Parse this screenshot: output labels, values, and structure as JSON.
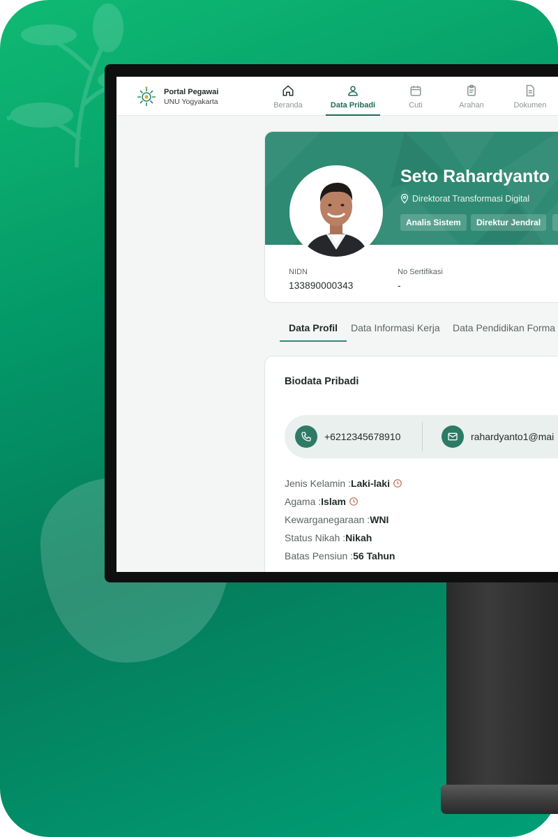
{
  "brand": {
    "title": "Portal Pegawai",
    "subtitle": "UNU Yogyakarta"
  },
  "nav": [
    {
      "label": "Beranda",
      "icon": "home-icon",
      "active": false
    },
    {
      "label": "Data Pribadi",
      "icon": "user-icon",
      "active": true
    },
    {
      "label": "Cuti",
      "icon": "calendar-icon",
      "active": false
    },
    {
      "label": "Arahan",
      "icon": "clipboard-icon",
      "active": false
    },
    {
      "label": "Dokumen",
      "icon": "document-icon",
      "active": false
    }
  ],
  "profile": {
    "name": "Seto Rahardyanto",
    "unit": "Direktorat Transformasi Digital",
    "chips": [
      "Analis Sistem",
      "Direktur Jendral"
    ],
    "nidn_label": "NIDN",
    "nidn_value": "133890000343",
    "cert_label": "No Sertifikasi",
    "cert_value": "-"
  },
  "tabs": [
    "Data Profil",
    "Data Informasi Kerja",
    "Data Pendidikan Forma"
  ],
  "biodata": {
    "title": "Biodata Pribadi",
    "phone": "+6212345678910",
    "email": "rahardyanto1@mai",
    "fields": [
      {
        "label": "Jenis Kelamin :",
        "value": "Laki-laki",
        "pending": true
      },
      {
        "label": "Agama :",
        "value": "Islam",
        "pending": true
      },
      {
        "label": "Kewarganegaraan :",
        "value": "WNI",
        "pending": false
      },
      {
        "label": "Status Nikah :",
        "value": "Nikah",
        "pending": false
      },
      {
        "label": "Batas Pensiun :",
        "value": "56 Tahun",
        "pending": false
      }
    ]
  },
  "colors": {
    "brand_green": "#2e8a72",
    "active_nav": "#1b6b57",
    "pending_icon": "#c0765a",
    "background_gradient_start": "#0fba73",
    "background_gradient_end": "#00a077"
  }
}
